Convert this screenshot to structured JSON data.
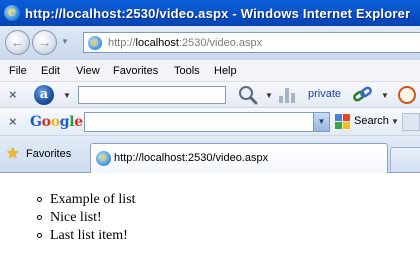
{
  "window": {
    "title": "http://localhost:2530/video.aspx - Windows Internet Explorer"
  },
  "address_bar": {
    "url_prefix": "http://",
    "url_host": "localhost",
    "url_rest": ":2530/video.aspx"
  },
  "menu": {
    "items": [
      "File",
      "Edit",
      "View",
      "Favorites",
      "Tools",
      "Help"
    ]
  },
  "search_toolbar": {
    "input_value": "",
    "private_label": "private"
  },
  "google_toolbar": {
    "logo_letters": [
      "G",
      "o",
      "o",
      "g",
      "l",
      "e"
    ],
    "input_value": "",
    "search_label": "Search"
  },
  "tabs": {
    "favorites_label": "Favorites",
    "active_tab_title": "http://localhost:2530/video.aspx"
  },
  "content": {
    "list_items": [
      "Example of list",
      "Nice list!",
      "Last list item!"
    ]
  },
  "colors": {
    "titlebar_blue": "#0a54cc",
    "google_letters": [
      "#1a5bd6",
      "#d62d20",
      "#f1b41c",
      "#1a5bd6",
      "#2a9a3a",
      "#d62d20"
    ]
  }
}
